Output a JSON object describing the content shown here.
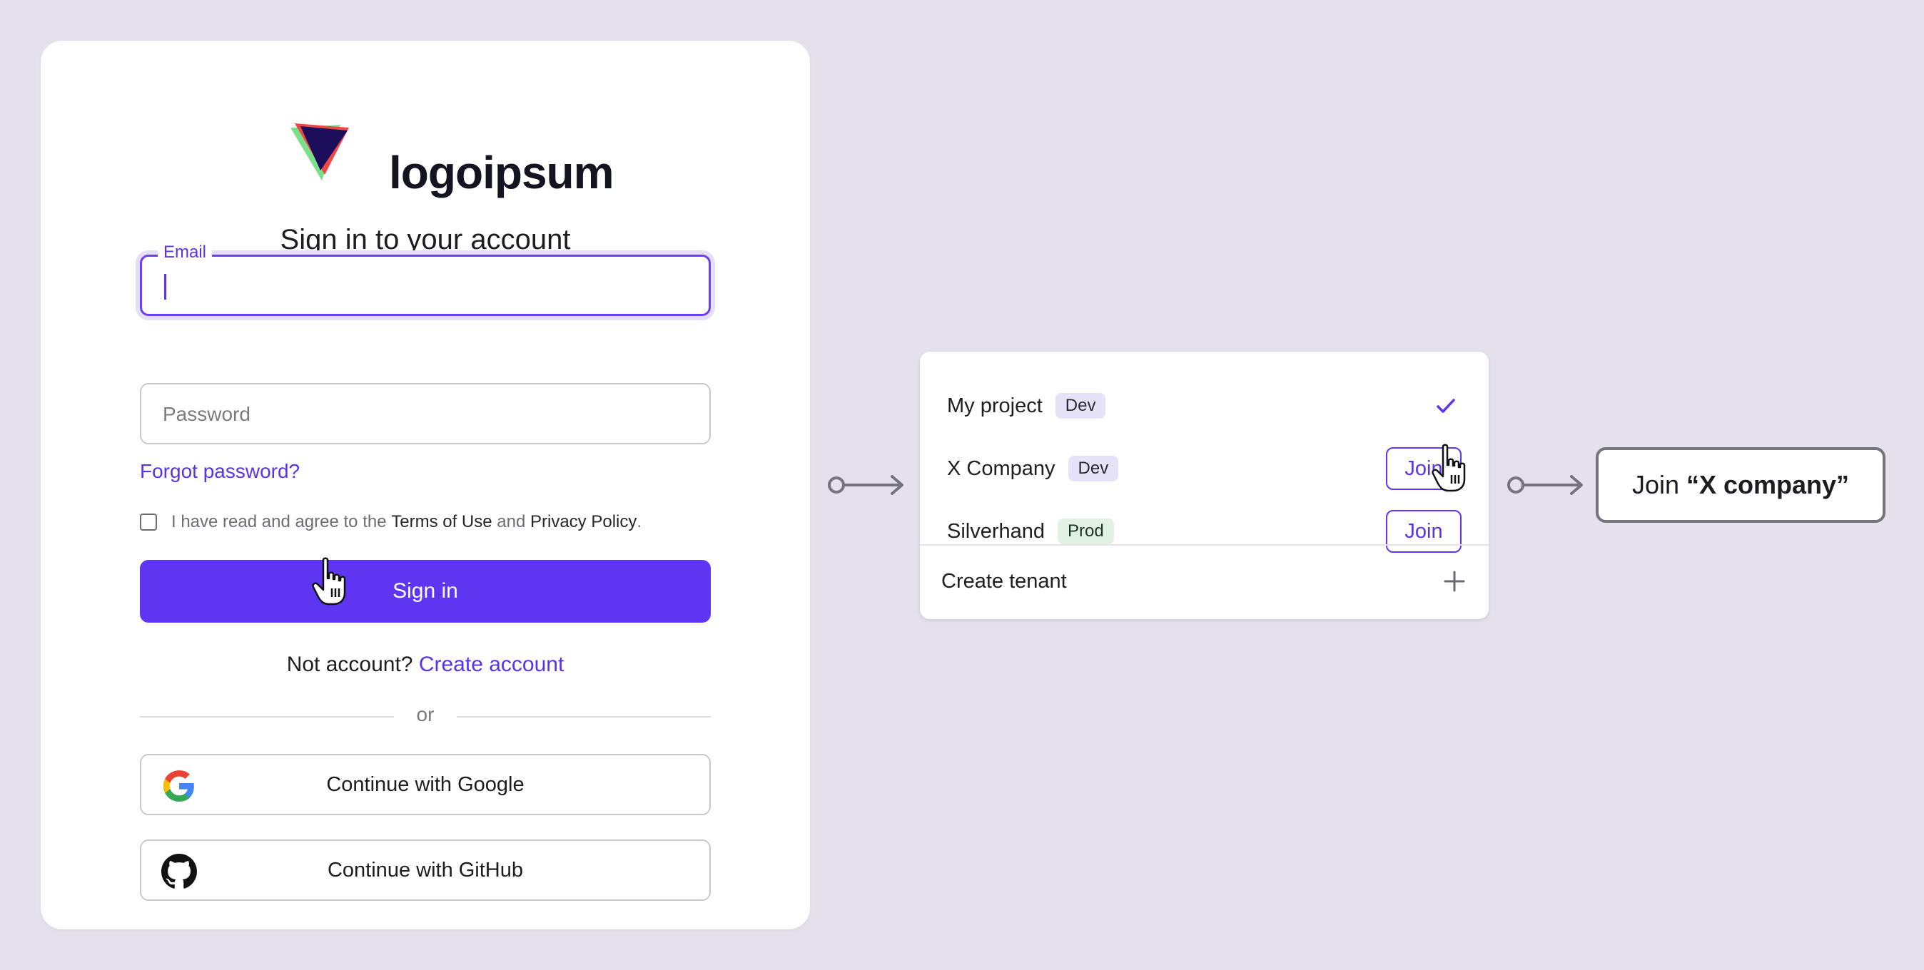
{
  "colors": {
    "background": "#e4e1ec",
    "accent": "#5e35f0",
    "link": "#5a33e8",
    "dev_tag": "#e6e2f8",
    "prod_tag": "#e1f2e4"
  },
  "login": {
    "logo_text": "logoipsum",
    "title": "Sign in to your account",
    "email": {
      "label": "Email",
      "value": ""
    },
    "password": {
      "placeholder": "Password"
    },
    "forgot_password": "Forgot password?",
    "terms": {
      "prefix": "I have read and agree to the ",
      "terms_link": "Terms of Use",
      "and": " and ",
      "privacy_link": "Privacy Policy",
      "suffix": ".",
      "checked": false
    },
    "sign_in": "Sign in",
    "no_account": "Not account?",
    "create_account": "Create account",
    "or": "or",
    "google": "Continue with Google",
    "github": "Continue with GitHub"
  },
  "tenant_menu": {
    "items": [
      {
        "name": "My project",
        "tag": "Dev",
        "selected": true
      },
      {
        "name": "X Company",
        "tag": "Dev",
        "action": "Join"
      },
      {
        "name": "Silverhand",
        "tag": "Prod",
        "action": "Join"
      }
    ],
    "create": "Create tenant"
  },
  "result": {
    "prefix": "Join ",
    "company": "“X company”"
  },
  "icons": [
    "logo-icon",
    "cursor-hand-icon",
    "google-icon",
    "github-icon",
    "checkmark-icon",
    "plus-icon",
    "arrow-connector-icon"
  ]
}
